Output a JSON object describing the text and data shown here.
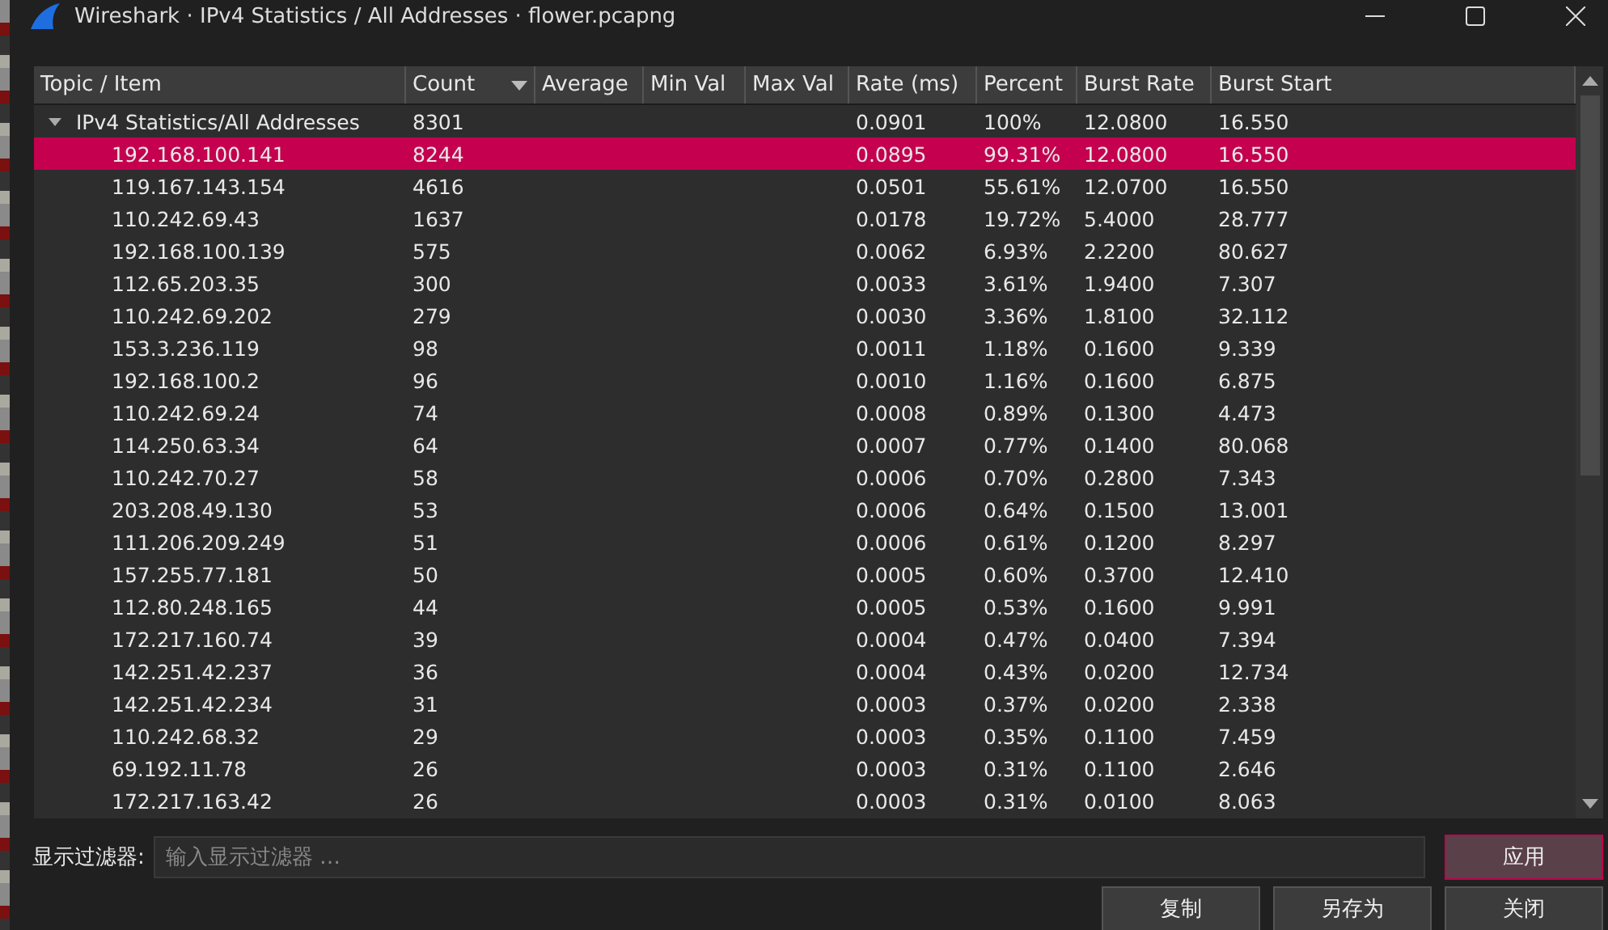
{
  "window": {
    "title": "Wireshark · IPv4 Statistics / All Addresses · flower.pcapng"
  },
  "table": {
    "columns": [
      {
        "label": "Topic / Item",
        "sorted": false
      },
      {
        "label": "Count",
        "sorted": true
      },
      {
        "label": "Average",
        "sorted": false
      },
      {
        "label": "Min Val",
        "sorted": false
      },
      {
        "label": "Max Val",
        "sorted": false
      },
      {
        "label": "Rate (ms)",
        "sorted": false
      },
      {
        "label": "Percent",
        "sorted": false
      },
      {
        "label": "Burst Rate",
        "sorted": false
      },
      {
        "label": "Burst Start",
        "sorted": false
      }
    ],
    "rows": [
      {
        "cells": [
          "IPv4 Statistics/All Addresses",
          "8301",
          "",
          "",
          "",
          "0.0901",
          "100%",
          "12.0800",
          "16.550"
        ],
        "expanded": true,
        "selected": false,
        "children": [
          {
            "cells": [
              "192.168.100.141",
              "8244",
              "",
              "",
              "",
              "0.0895",
              "99.31%",
              "12.0800",
              "16.550"
            ],
            "selected": true
          },
          {
            "cells": [
              "119.167.143.154",
              "4616",
              "",
              "",
              "",
              "0.0501",
              "55.61%",
              "12.0700",
              "16.550"
            ],
            "selected": false
          },
          {
            "cells": [
              "110.242.69.43",
              "1637",
              "",
              "",
              "",
              "0.0178",
              "19.72%",
              "5.4000",
              "28.777"
            ],
            "selected": false
          },
          {
            "cells": [
              "192.168.100.139",
              "575",
              "",
              "",
              "",
              "0.0062",
              "6.93%",
              "2.2200",
              "80.627"
            ],
            "selected": false
          },
          {
            "cells": [
              "112.65.203.35",
              "300",
              "",
              "",
              "",
              "0.0033",
              "3.61%",
              "1.9400",
              "7.307"
            ],
            "selected": false
          },
          {
            "cells": [
              "110.242.69.202",
              "279",
              "",
              "",
              "",
              "0.0030",
              "3.36%",
              "1.8100",
              "32.112"
            ],
            "selected": false
          },
          {
            "cells": [
              "153.3.236.119",
              "98",
              "",
              "",
              "",
              "0.0011",
              "1.18%",
              "0.1600",
              "9.339"
            ],
            "selected": false
          },
          {
            "cells": [
              "192.168.100.2",
              "96",
              "",
              "",
              "",
              "0.0010",
              "1.16%",
              "0.1600",
              "6.875"
            ],
            "selected": false
          },
          {
            "cells": [
              "110.242.69.24",
              "74",
              "",
              "",
              "",
              "0.0008",
              "0.89%",
              "0.1300",
              "4.473"
            ],
            "selected": false
          },
          {
            "cells": [
              "114.250.63.34",
              "64",
              "",
              "",
              "",
              "0.0007",
              "0.77%",
              "0.1400",
              "80.068"
            ],
            "selected": false
          },
          {
            "cells": [
              "110.242.70.27",
              "58",
              "",
              "",
              "",
              "0.0006",
              "0.70%",
              "0.2800",
              "7.343"
            ],
            "selected": false
          },
          {
            "cells": [
              "203.208.49.130",
              "53",
              "",
              "",
              "",
              "0.0006",
              "0.64%",
              "0.1500",
              "13.001"
            ],
            "selected": false
          },
          {
            "cells": [
              "111.206.209.249",
              "51",
              "",
              "",
              "",
              "0.0006",
              "0.61%",
              "0.1200",
              "8.297"
            ],
            "selected": false
          },
          {
            "cells": [
              "157.255.77.181",
              "50",
              "",
              "",
              "",
              "0.0005",
              "0.60%",
              "0.3700",
              "12.410"
            ],
            "selected": false
          },
          {
            "cells": [
              "112.80.248.165",
              "44",
              "",
              "",
              "",
              "0.0005",
              "0.53%",
              "0.1600",
              "9.991"
            ],
            "selected": false
          },
          {
            "cells": [
              "172.217.160.74",
              "39",
              "",
              "",
              "",
              "0.0004",
              "0.47%",
              "0.0400",
              "7.394"
            ],
            "selected": false
          },
          {
            "cells": [
              "142.251.42.237",
              "36",
              "",
              "",
              "",
              "0.0004",
              "0.43%",
              "0.0200",
              "12.734"
            ],
            "selected": false
          },
          {
            "cells": [
              "142.251.42.234",
              "31",
              "",
              "",
              "",
              "0.0003",
              "0.37%",
              "0.0200",
              "2.338"
            ],
            "selected": false
          },
          {
            "cells": [
              "110.242.68.32",
              "29",
              "",
              "",
              "",
              "0.0003",
              "0.35%",
              "0.1100",
              "7.459"
            ],
            "selected": false
          },
          {
            "cells": [
              "69.192.11.78",
              "26",
              "",
              "",
              "",
              "0.0003",
              "0.31%",
              "0.1100",
              "2.646"
            ],
            "selected": false
          },
          {
            "cells": [
              "172.217.163.42",
              "26",
              "",
              "",
              "",
              "0.0003",
              "0.31%",
              "0.0100",
              "8.063"
            ],
            "selected": false
          }
        ]
      }
    ]
  },
  "filter": {
    "label": "显示过滤器:",
    "placeholder": "输入显示过滤器 …",
    "apply": "应用"
  },
  "buttons": [
    "复制",
    "另存为",
    "关闭"
  ]
}
